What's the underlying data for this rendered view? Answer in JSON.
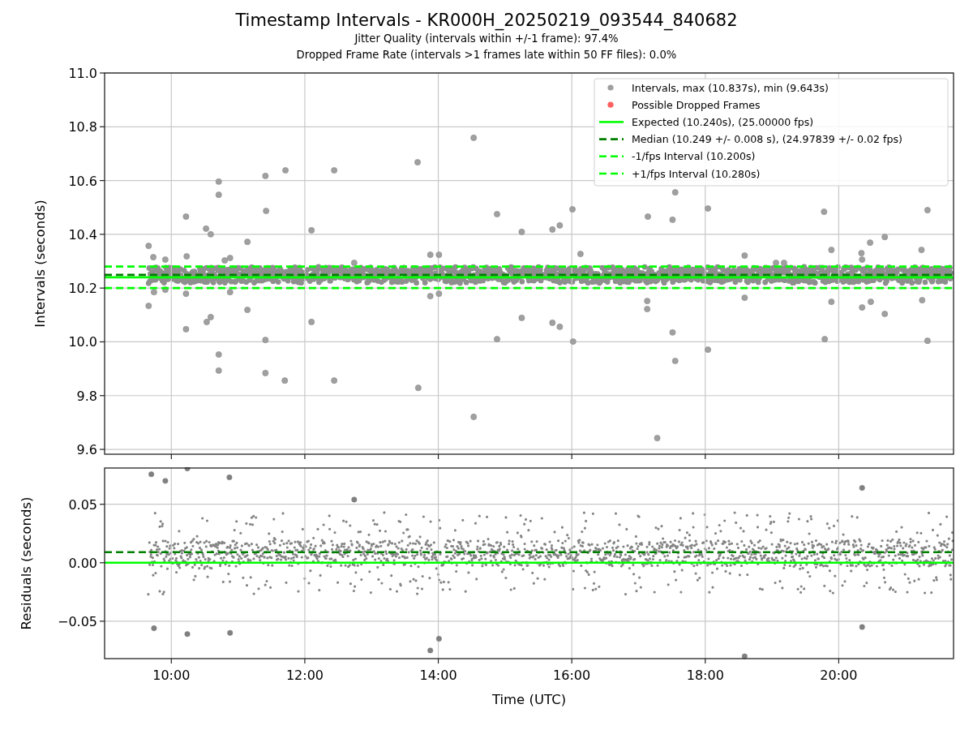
{
  "figure": {
    "title": "Timestamp Intervals - KR000H_20250219_093544_840682",
    "subtitle_lines": [
      "Jitter Quality (intervals within +/-1 frame): 97.4%",
      "Dropped Frame Rate (intervals >1 frames late within 50 FF files): 0.0%"
    ]
  },
  "intervals_plot": {
    "chart_data": {
      "type": "scatter",
      "ylabel": "Intervals (seconds)",
      "grid": true,
      "xlim": [
        9.0,
        21.72
      ],
      "ylim": [
        9.582,
        11.0
      ],
      "yticks": [
        {
          "value": 9.6,
          "label": "9.6"
        },
        {
          "value": 9.8,
          "label": "9.8"
        },
        {
          "value": 10.0,
          "label": "10.0"
        },
        {
          "value": 10.2,
          "label": "10.2"
        },
        {
          "value": 10.4,
          "label": "10.4"
        },
        {
          "value": 10.6,
          "label": "10.6"
        },
        {
          "value": 10.8,
          "label": "10.8"
        },
        {
          "value": 11.0,
          "label": "11.0"
        }
      ],
      "series": [
        {
          "name": "Intervals, max (10.837s), min (9.643s)",
          "color": "#a0a0a0",
          "x": [
            9.66,
            9.73,
            9.66,
            9.74,
            9.91,
            9.91,
            10.22,
            10.22,
            10.22,
            10.23,
            10.52,
            10.59,
            10.53,
            10.59,
            10.71,
            10.71,
            10.71,
            10.71,
            10.8,
            10.88,
            10.88,
            11.14,
            11.14,
            11.41,
            11.42,
            11.41,
            11.41,
            11.71,
            11.7,
            12.1,
            12.1,
            12.44,
            12.44,
            12.74,
            13.69,
            13.7,
            13.88,
            14.01,
            13.88,
            14.01,
            14.53,
            14.53,
            14.88,
            14.88,
            15.25,
            15.25,
            15.71,
            15.82,
            15.71,
            15.82,
            16.01,
            16.02,
            16.13,
            17.14,
            17.13,
            17.13,
            17.28,
            17.51,
            17.55,
            17.51,
            17.55,
            18.04,
            18.04,
            18.59,
            18.59,
            19.06,
            19.18,
            19.78,
            19.79,
            19.89,
            19.89,
            20.34,
            20.35,
            20.35,
            20.47,
            20.48,
            20.69,
            20.69,
            21.24,
            21.25,
            21.33,
            21.33
          ],
          "values": [
            10.357,
            10.315,
            10.134,
            10.185,
            10.306,
            10.194,
            10.466,
            10.179,
            10.047,
            10.318,
            10.421,
            10.4,
            10.074,
            10.092,
            10.596,
            10.547,
            9.953,
            9.893,
            10.303,
            10.312,
            10.185,
            10.372,
            10.119,
            10.617,
            10.487,
            10.007,
            9.884,
            10.638,
            9.856,
            10.415,
            10.074,
            10.638,
            9.856,
            10.294,
            10.668,
            9.829,
            10.324,
            10.324,
            10.17,
            10.179,
            10.759,
            9.721,
            10.475,
            10.01,
            10.409,
            10.089,
            10.418,
            10.433,
            10.071,
            10.056,
            10.493,
            10.001,
            10.327,
            10.466,
            10.152,
            10.122,
            9.642,
            10.454,
            10.556,
            10.035,
            9.929,
            10.496,
            9.971,
            10.321,
            10.164,
            10.294,
            10.294,
            10.484,
            10.01,
            10.342,
            10.149,
            10.33,
            10.306,
            10.128,
            10.369,
            10.149,
            10.39,
            10.104,
            10.342,
            10.155,
            10.49,
            10.004
          ]
        },
        {
          "name": "Possible Dropped Frames",
          "color": "#ff6060"
        }
      ],
      "ref_lines": [
        {
          "axis": "y",
          "value": 10.24,
          "label": "Expected (10.240s), (25.00000 fps)",
          "color": "#00ff00"
        },
        {
          "axis": "y",
          "value": 10.249,
          "label": "Median (10.249 +/- 0.008 s), (24.97839 +/- 0.02 fps)",
          "color": "#008000"
        },
        {
          "axis": "y",
          "value": 10.2,
          "label": "-1/fps Interval (10.200s)",
          "color": "#00ff00"
        },
        {
          "axis": "y",
          "value": 10.28,
          "label": "+1/fps Interval (10.280s)",
          "color": "#00ff00"
        }
      ],
      "legend": true
    }
  },
  "residuals_plot": {
    "chart_data": {
      "type": "scatter",
      "xlabel": "Time (UTC)",
      "ylabel": "Residuals (seconds)",
      "grid": true,
      "xlim": [
        9.0,
        21.72
      ],
      "ylim": [
        -0.082,
        0.081
      ],
      "xticks": [
        {
          "value": 10,
          "label": "10:00"
        },
        {
          "value": 12,
          "label": "12:00"
        },
        {
          "value": 14,
          "label": "14:00"
        },
        {
          "value": 16,
          "label": "16:00"
        },
        {
          "value": 18,
          "label": "18:00"
        },
        {
          "value": 20,
          "label": "20:00"
        }
      ],
      "yticks": [
        {
          "value": -0.05,
          "label": "−0.05"
        },
        {
          "value": 0,
          "label": "0.00"
        },
        {
          "value": 0.05,
          "label": "0.05"
        }
      ],
      "series": [
        {
          "color": "#808080",
          "x": [
            9.7,
            9.91,
            10.24,
            10.87,
            12.74,
            14.01,
            13.88,
            9.74,
            10.24,
            10.88,
            18.59,
            20.35,
            20.35
          ],
          "values": [
            0.0757,
            0.07,
            0.0806,
            0.073,
            0.054,
            -0.065,
            -0.075,
            -0.056,
            -0.061,
            -0.06,
            -0.08,
            0.064,
            -0.055
          ]
        }
      ],
      "ref_lines": [
        {
          "axis": "y",
          "value": 0,
          "color": "#00ff00"
        },
        {
          "axis": "y",
          "value": 0.009,
          "color": "#008000"
        }
      ]
    }
  }
}
